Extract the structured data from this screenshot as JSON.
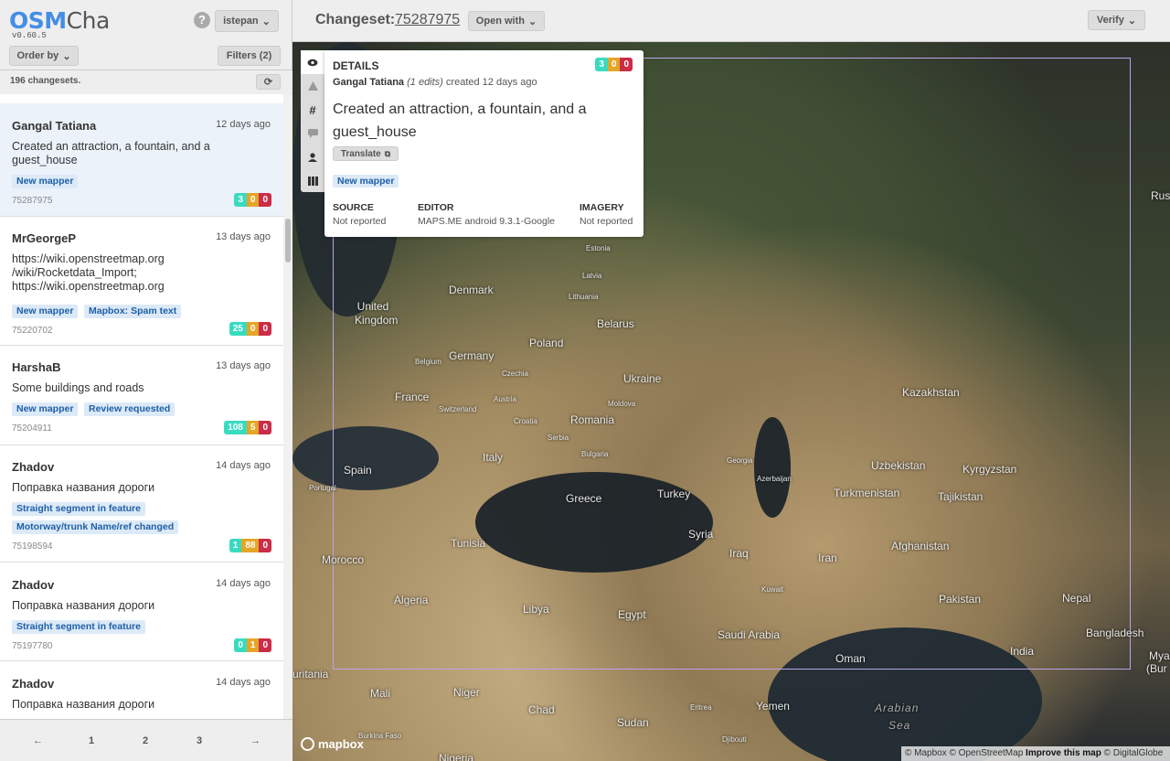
{
  "brand": {
    "osm": "OSM",
    "cha": "Cha",
    "version": "v0.60.5"
  },
  "header_user": {
    "help": "?",
    "username": "istepan"
  },
  "controls": {
    "order_by": "Order by",
    "filters": "Filters (2)"
  },
  "list_count": "196 changesets.",
  "changesets": [
    {
      "user": "Gangal Tatiana",
      "date": "12 days ago",
      "comment_lines": [
        "Created an attraction, a fountain, and a",
        "guest_house"
      ],
      "tags": [
        "New mapper"
      ],
      "id": "75287975",
      "stats": [
        "3",
        "0",
        "0"
      ]
    },
    {
      "user": "MrGeorgeP",
      "date": "13 days ago",
      "comment_lines": [
        "https://wiki.openstreetmap.org",
        "/wiki/Rocketdata_Import;",
        "https://wiki.openstreetmap.org"
      ],
      "tags": [
        "New mapper",
        "Mapbox: Spam text"
      ],
      "id": "75220702",
      "stats": [
        "25",
        "0",
        "0"
      ]
    },
    {
      "user": "HarshaB",
      "date": "13 days ago",
      "comment_lines": [
        "Some buildings and roads"
      ],
      "tags": [
        "New mapper",
        "Review requested"
      ],
      "id": "75204911",
      "stats": [
        "108",
        "5",
        "0"
      ]
    },
    {
      "user": "Zhadov",
      "date": "14 days ago",
      "comment_lines": [
        "Поправка названия дороги"
      ],
      "tags": [
        "Straight segment in feature",
        "Motorway/trunk Name/ref changed"
      ],
      "id": "75198594",
      "stats": [
        "1",
        "88",
        "0"
      ]
    },
    {
      "user": "Zhadov",
      "date": "14 days ago",
      "comment_lines": [
        "Поправка названия дороги"
      ],
      "tags": [
        "Straight segment in feature"
      ],
      "id": "75197780",
      "stats": [
        "0",
        "1",
        "0"
      ]
    },
    {
      "user": "Zhadov",
      "date": "14 days ago",
      "comment_lines": [
        "Поправка названия дороги"
      ],
      "tags": [],
      "id": "",
      "stats": []
    }
  ],
  "pagination": {
    "prev": "←",
    "pages": [
      "1",
      "2",
      "3"
    ],
    "next": "→"
  },
  "header": {
    "label": "Changeset:",
    "changeset_id": "75287975",
    "open_with": "Open with",
    "verify": "Verify"
  },
  "details": {
    "title": "DETAILS",
    "user": "Gangal Tatiana",
    "edits": "(1 edits)",
    "created": "created 12 days ago",
    "comment_lines": [
      "Created an attraction, a fountain, and a",
      "guest_house"
    ],
    "translate": "Translate",
    "tag": "New mapper",
    "stats": [
      "3",
      "0",
      "0"
    ],
    "source_label": "SOURCE",
    "source": "Not reported",
    "editor_label": "EDITOR",
    "editor": "MAPS.ME android 9.3.1-Google",
    "imagery_label": "IMAGERY",
    "imagery": "Not reported"
  },
  "map": {
    "places": [
      "United Kingdom",
      "Denmark",
      "Estonia",
      "Latvia",
      "Lithuania",
      "Belarus",
      "Poland",
      "Germany",
      "Belgium",
      "Czechia",
      "Ukraine",
      "France",
      "Switzerland",
      "Austria",
      "Moldova",
      "Croatia",
      "Romania",
      "Serbia",
      "Bulgaria",
      "Italy",
      "Spain",
      "Portugal",
      "Greece",
      "Turkey",
      "Georgia",
      "Azerbaijan",
      "Kazakhstan",
      "Uzbekistan",
      "Kyrgyzstan",
      "Turkmenistan",
      "Tajikistan",
      "Tunisia",
      "Syria",
      "Iraq",
      "Iran",
      "Afghanistan",
      "Morocco",
      "Algeria",
      "Libya",
      "Egypt",
      "Kuwait",
      "Pakistan",
      "Nepal",
      "Saudi Arabia",
      "Oman",
      "Bangladesh",
      "India",
      "Mali",
      "Niger",
      "Chad",
      "Sudan",
      "Yemen",
      "Eritrea",
      "Djibouti",
      "Burkina Faso",
      "Nigeria",
      "Rus",
      "Myan",
      "(Bur",
      "uritania"
    ],
    "sea": [
      "Arabian",
      "Sea"
    ],
    "mapbox": "mapbox",
    "attribution": {
      "mapbox": "© Mapbox",
      "osm": "© OpenStreetMap",
      "improve": "Improve this map",
      "dg": "© DigitalGlobe"
    }
  }
}
